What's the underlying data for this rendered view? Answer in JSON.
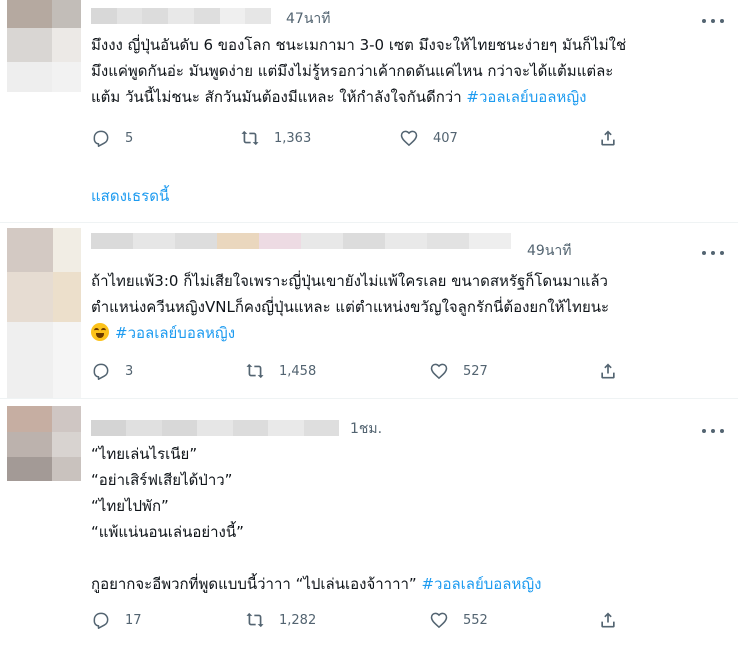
{
  "tweets": [
    {
      "time": "47นาที",
      "lines": [
        "มึงงง ญี่ปุ่นอันดับ 6 ของโลก ชนะเมกามา 3-0 เซต มึงจะให้ไทยชนะง่ายๆ มันก็ไม่ใช่",
        "มึงแค่พูดกันอ่ะ มันพูดง่าย แต่มึงไม่รู้หรอกว่าเค้ากดดันแค่ไหน กว่าจะได้แต้มแต่ละ",
        "แต้ม วันนี้ไม่ชนะ สักวันมันต้องมีแหละ  ให้กำลังใจกันดีกว่า "
      ],
      "hashtag": "#วอลเลย์บอลหญิง",
      "replies": "5",
      "retweets": "1,363",
      "likes": "407",
      "show_thread": "แสดงเธรดนี้",
      "avatar_colors": [
        "#b5a9a0",
        "#c2bdb8",
        "#d9d6d3",
        "#ece9e6",
        "#eeeeee",
        "#f2f2f2"
      ],
      "name_colors": [
        "#d8d8d8",
        "#e3e3e3",
        "#dcdcdc",
        "#e8e8e8",
        "#dedede",
        "#efefef",
        "#e6e6e6"
      ]
    },
    {
      "time": "49นาที",
      "lines": [
        "ถ้าไทยแพ้3:0 ก็ไม่เสียใจเพราะญี่ปุ่นเขายังไม่แพ้ใครเลย ขนาดสหรัฐก็โดนมาแล้ว",
        "ตำแหน่งควีนหญิงVNLก็คงญี่ปุ่นแหละ แต่ตำแหน่งขวัญใจลูกรักนี่ต้องยกให้ไทยนะ"
      ],
      "hashtag": "#วอลเลย์บอลหญิง",
      "emoji": "face-with-tears-of-joy",
      "replies": "3",
      "retweets": "1,458",
      "likes": "527",
      "avatar_colors": [
        "#d3c9c3",
        "#f1ede4",
        "#e6dcd2",
        "#ecdfcb",
        "#efefef",
        "#f5f5f5"
      ],
      "name_colors": [
        "#dadada",
        "#e6e6e6",
        "#dddddd",
        "#ead7be",
        "#eddbe3",
        "#e8e8e8",
        "#dcdcdc",
        "#e9e9e9",
        "#e2e2e2",
        "#eeeeee"
      ]
    },
    {
      "time": "1ชม.",
      "lines": [
        "“ไทยเล่นไรเนีย”",
        "“อย่าเสิร์ฟเสียได้ป่าว”",
        "“ไทยไปพัก”",
        "“แพ้แน่นอนเล่นอย่างนี้”",
        "",
        "กูอยากจะอีพวกที่พูดแบบนี้ว่าาา  “ไปเล่นเองจ้าาาา”  "
      ],
      "hashtag": "#วอลเลย์บอลหญิง",
      "replies": "17",
      "retweets": "1,282",
      "likes": "552",
      "avatar_colors": [
        "#c6aea2",
        "#cfc6c3",
        "#bcb2ad",
        "#d8d3d0",
        "#a39a96",
        "#c9c2be"
      ],
      "name_colors": [
        "#d4d4d4",
        "#e0e0e0",
        "#d8d8d8",
        "#e6e6e6",
        "#dcdcdc",
        "#e9e9e9",
        "#dedede"
      ]
    }
  ],
  "icons": {
    "reply": "reply-icon",
    "retweet": "retweet-icon",
    "like": "like-icon",
    "share": "share-icon",
    "more": "more-icon"
  },
  "colors": {
    "accent": "#1d9bf0",
    "secondary_text": "#536471",
    "divider": "#eff3f4"
  }
}
